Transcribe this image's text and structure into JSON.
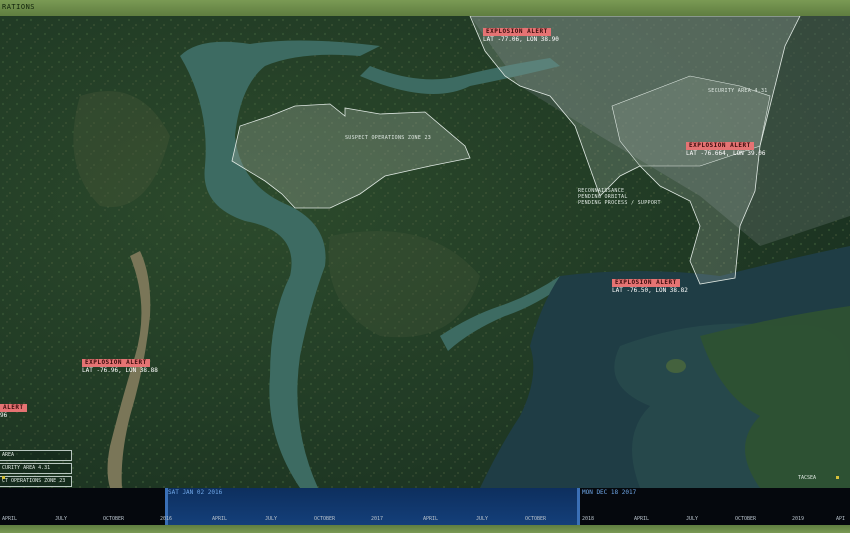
{
  "header": {
    "title": "RATIONS"
  },
  "alerts": [
    {
      "label": "EXPLOSION ALERT",
      "coords": "LAT -77.06, LON 38.90"
    },
    {
      "label": "EXPLOSION ALERT",
      "coords": "LAT -76.664, LON 39.06"
    },
    {
      "label": "EXPLOSION ALERT",
      "coords": "LAT -76.50, LON 38.82"
    },
    {
      "label": "EXPLOSION ALERT",
      "coords": "LAT -76.96, LON 38.88"
    },
    {
      "label": "ALERT",
      "coords": "96"
    }
  ],
  "zones": {
    "suspect": "SUSPECT OPERATIONS ZONE 23",
    "security": "SECURITY AREA 4.31",
    "reconnaissance": "RECONNAISSANCE\nPENDING ORBITAL\nPENDING PROCESS / SUPPORT"
  },
  "legend": [
    {
      "label": "AREA"
    },
    {
      "label": "CURITY AREA 4.31"
    },
    {
      "label": "CT OPERATIONS ZONE 23"
    }
  ],
  "attribution": "TACSEA",
  "timeline": {
    "start_date": "SAT JAN 02 2016",
    "end_date": "MON DEC 18 2017",
    "ticks": [
      "APRIL",
      "JULY",
      "OCTOBER",
      "2016",
      "APRIL",
      "JULY",
      "OCTOBER",
      "2017",
      "APRIL",
      "JULY",
      "OCTOBER",
      "2018",
      "APRIL",
      "JULY",
      "OCTOBER",
      "2019",
      "API"
    ]
  },
  "colors": {
    "alert_badge": "#e57373",
    "timeline_selection": "#143f7a",
    "frame": "#6a8a48"
  }
}
